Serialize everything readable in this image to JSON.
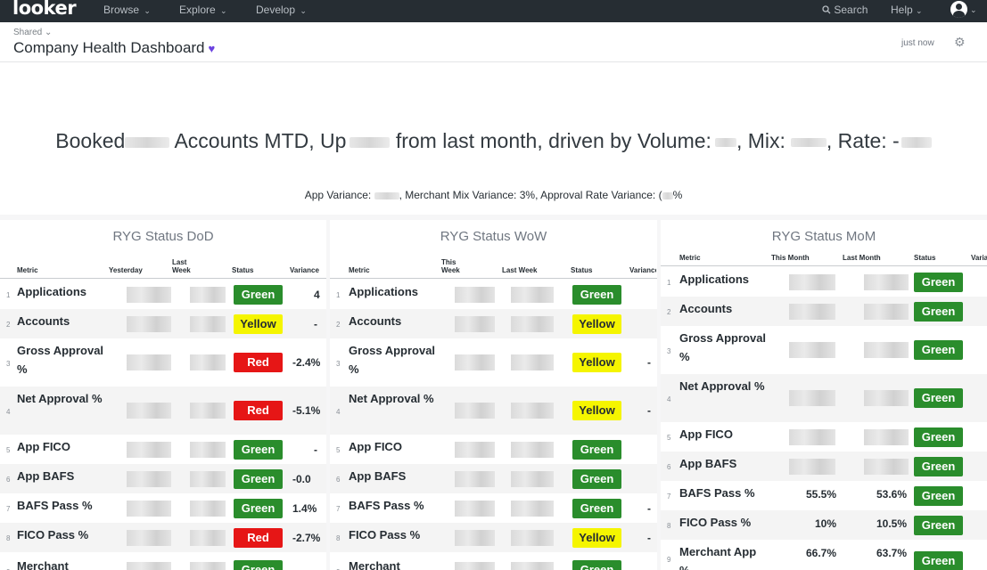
{
  "nav": {
    "logo": "looker",
    "items": [
      {
        "label": "Browse",
        "caret": "⌄"
      },
      {
        "label": "Explore",
        "caret": "⌄"
      },
      {
        "label": "Develop",
        "caret": "⌄"
      }
    ],
    "search_label": "Search",
    "help_label": "Help"
  },
  "header": {
    "breadcrumb": "Shared",
    "title": "Company Health Dashboard",
    "updated": "just now"
  },
  "summary": {
    "headline_parts": [
      "Booked",
      "Accounts MTD, Up",
      "from last month, driven by Volume:",
      ", Mix:",
      ", Rate: -"
    ],
    "subline_parts": [
      "App Variance:",
      ", Merchant Mix Variance: 3%, Approval Rate Variance: (",
      "%"
    ]
  },
  "tiles": [
    {
      "title": "RYG Status DoD",
      "columns": [
        "Metric",
        "Yesterday",
        "Last Week",
        "Status",
        "Variance"
      ],
      "rows": [
        {
          "num": "1",
          "metric": "Applications",
          "status": "Green",
          "variance": "4"
        },
        {
          "num": "2",
          "metric": "Accounts",
          "status": "Yellow",
          "variance": "-"
        },
        {
          "num": "3",
          "metric": "Gross Approval %",
          "status": "Red",
          "variance": "-2.4%"
        },
        {
          "num": "4",
          "metric": "Net Approval %",
          "status": "Red",
          "variance": "-5.1%"
        },
        {
          "num": "5",
          "metric": "App FICO",
          "status": "Green",
          "variance": "-"
        },
        {
          "num": "6",
          "metric": "App BAFS",
          "status": "Green",
          "variance": "-0.0"
        },
        {
          "num": "7",
          "metric": "BAFS Pass %",
          "status": "Green",
          "variance": "1.4%"
        },
        {
          "num": "8",
          "metric": "FICO Pass %",
          "status": "Red",
          "variance": "-2.7%"
        },
        {
          "num": "9",
          "metric": "Merchant",
          "status": "Green",
          "variance": ""
        }
      ]
    },
    {
      "title": "RYG Status WoW",
      "columns": [
        "Metric",
        "This Week",
        "Last Week",
        "Status",
        "Variance"
      ],
      "rows": [
        {
          "num": "1",
          "metric": "Applications",
          "status": "Green",
          "variance": ""
        },
        {
          "num": "2",
          "metric": "Accounts",
          "status": "Yellow",
          "variance": ""
        },
        {
          "num": "3",
          "metric": "Gross Approval %",
          "status": "Yellow",
          "variance": "-"
        },
        {
          "num": "4",
          "metric": "Net Approval %",
          "status": "Yellow",
          "variance": "-"
        },
        {
          "num": "5",
          "metric": "App FICO",
          "status": "Green",
          "variance": ""
        },
        {
          "num": "6",
          "metric": "App BAFS",
          "status": "Green",
          "variance": ""
        },
        {
          "num": "7",
          "metric": "BAFS Pass %",
          "status": "Green",
          "variance": "-"
        },
        {
          "num": "8",
          "metric": "FICO Pass %",
          "status": "Yellow",
          "variance": "-"
        },
        {
          "num": "9",
          "metric": "Merchant",
          "status": "Green",
          "variance": ""
        }
      ]
    },
    {
      "title": "RYG Status MoM",
      "columns": [
        "Metric",
        "This Month",
        "Last Month",
        "Status",
        "Variance"
      ],
      "rows": [
        {
          "num": "1",
          "metric": "Applications",
          "this": "",
          "last": "",
          "status": "Green"
        },
        {
          "num": "2",
          "metric": "Accounts",
          "this": "",
          "last": "",
          "status": "Green"
        },
        {
          "num": "3",
          "metric": "Gross Approval %",
          "this": "",
          "last": "",
          "status": "Green"
        },
        {
          "num": "4",
          "metric": "Net Approval %",
          "this": "",
          "last": "",
          "status": "Green"
        },
        {
          "num": "5",
          "metric": "App FICO",
          "this": "",
          "last": "",
          "status": "Green"
        },
        {
          "num": "6",
          "metric": "App BAFS",
          "this": "",
          "last": "",
          "status": "Green"
        },
        {
          "num": "7",
          "metric": "BAFS Pass %",
          "this": "55.5%",
          "last": "53.6%",
          "status": "Green"
        },
        {
          "num": "8",
          "metric": "FICO Pass %",
          "this": "10%",
          "last": "10.5%",
          "status": "Green"
        },
        {
          "num": "9",
          "metric": "Merchant App %",
          "this": "66.7%",
          "last": "63.7%",
          "status": "Green"
        }
      ]
    }
  ]
}
